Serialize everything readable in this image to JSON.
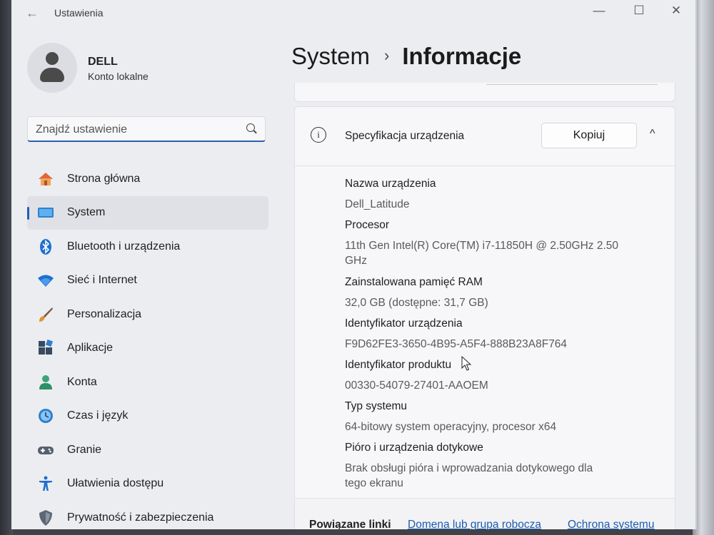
{
  "app": {
    "title": "Ustawienia"
  },
  "window_controls": {
    "minimize": "—",
    "maximize": "☐",
    "close": "✕"
  },
  "account": {
    "name": "DELL",
    "type": "Konto lokalne"
  },
  "search": {
    "placeholder": "Znajdź ustawienie"
  },
  "nav": {
    "items": [
      {
        "label": "Strona główna",
        "icon": "home-icon"
      },
      {
        "label": "System",
        "icon": "system-icon",
        "active": true
      },
      {
        "label": "Bluetooth i urządzenia",
        "icon": "bluetooth-icon"
      },
      {
        "label": "Sieć i Internet",
        "icon": "wifi-icon"
      },
      {
        "label": "Personalizacja",
        "icon": "brush-icon"
      },
      {
        "label": "Aplikacje",
        "icon": "apps-icon"
      },
      {
        "label": "Konta",
        "icon": "person-icon"
      },
      {
        "label": "Czas i język",
        "icon": "clock-icon"
      },
      {
        "label": "Granie",
        "icon": "gamepad-icon"
      },
      {
        "label": "Ułatwienia dostępu",
        "icon": "accessibility-icon"
      },
      {
        "label": "Prywatność i zabezpieczenia",
        "icon": "shield-icon"
      }
    ]
  },
  "header": {
    "parent": "System",
    "separator": "›",
    "current": "Informacje"
  },
  "specs": {
    "title": "Specyfikacja urządzenia",
    "copy_label": "Kopiuj",
    "collapse_glyph": "^",
    "items": [
      {
        "label": "Nazwa urządzenia",
        "value": "Dell_Latitude"
      },
      {
        "label": "Procesor",
        "value": "11th Gen Intel(R) Core(TM) i7-11850H @ 2.50GHz   2.50 GHz"
      },
      {
        "label": "Zainstalowana pamięć RAM",
        "value": "32,0 GB (dostępne: 31,7 GB)"
      },
      {
        "label": "Identyfikator urządzenia",
        "value": "F9D62FE3-3650-4B95-A5F4-888B23A8F764"
      },
      {
        "label": "Identyfikator produktu",
        "value": "00330-54079-27401-AAOEM"
      },
      {
        "label": "Typ systemu",
        "value": "64-bitowy system operacyjny, procesor x64"
      },
      {
        "label": "Pióro i urządzenia dotykowe",
        "value": "Brak obsługi pióra i wprowadzania dotykowego dla tego ekranu"
      }
    ]
  },
  "related": {
    "label": "Powiązane linki",
    "links": [
      "Domena lub grupa robocza",
      "Ochrona systemu"
    ]
  }
}
